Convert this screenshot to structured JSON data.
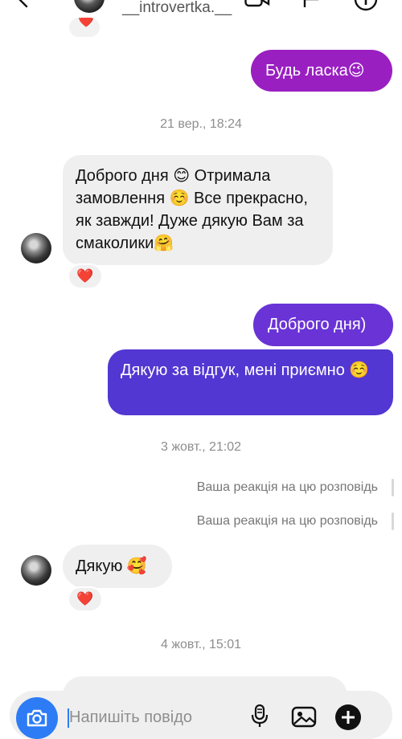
{
  "header": {
    "username": "__introvertka.__",
    "icons": [
      "back-icon",
      "avatar",
      "video-icon",
      "flag-icon",
      "info-icon"
    ]
  },
  "messages": {
    "out_1": "Будь ласка😉",
    "timestamp_1": "21 вер., 18:24",
    "in_1": "Доброго дня 😊 Отримала замовлення ☺️ Все прекрасно, як завжди! Дуже дякую Вам за смаколики🤗",
    "in_1_reaction": "❤️",
    "out_2": "Доброго дня)",
    "out_3": "Дякую за відгук, мені приємно ☺️",
    "timestamp_2": "3 жовт., 21:02",
    "story_reaction_1": "Ваша реакція на цю розповідь",
    "story_reaction_2": "Ваша реакція на цю розповідь",
    "in_2": "Дякую 🥰",
    "in_2_reaction": "❤️",
    "timestamp_3": "4 жовт., 15:01",
    "top_reaction": "❤️"
  },
  "composer": {
    "placeholder": "Напишіть повідо"
  },
  "colors": {
    "out_purple": "#9a1fc1",
    "out_violet": "#6a33d6",
    "out_indigo": "#5337d2",
    "incoming_bg": "#efefef",
    "camera_blue": "#2d7cf6"
  }
}
